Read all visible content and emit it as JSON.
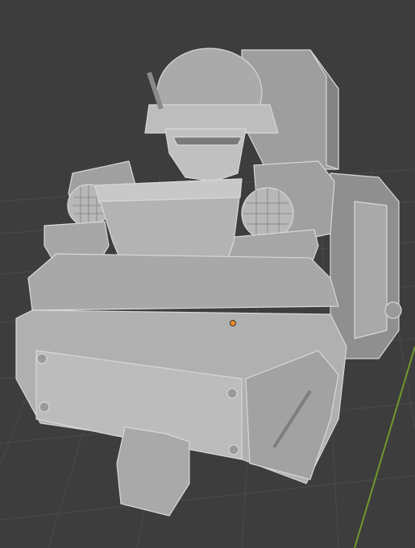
{
  "viewport": {
    "background_color": "#3d3d3d",
    "grid_color": "#4a4a4a",
    "axis_y_color": "#6f9a2c",
    "model_base_color": "#b4b4b4",
    "model_shadow_color": "#8a8a8a",
    "model_dark_color": "#6e6e6e",
    "model_highlight_color": "#e4e4e4",
    "origin_color": "#f08a1c",
    "model": "armored-robot-mech",
    "origin_marker": "object-origin-dot"
  }
}
